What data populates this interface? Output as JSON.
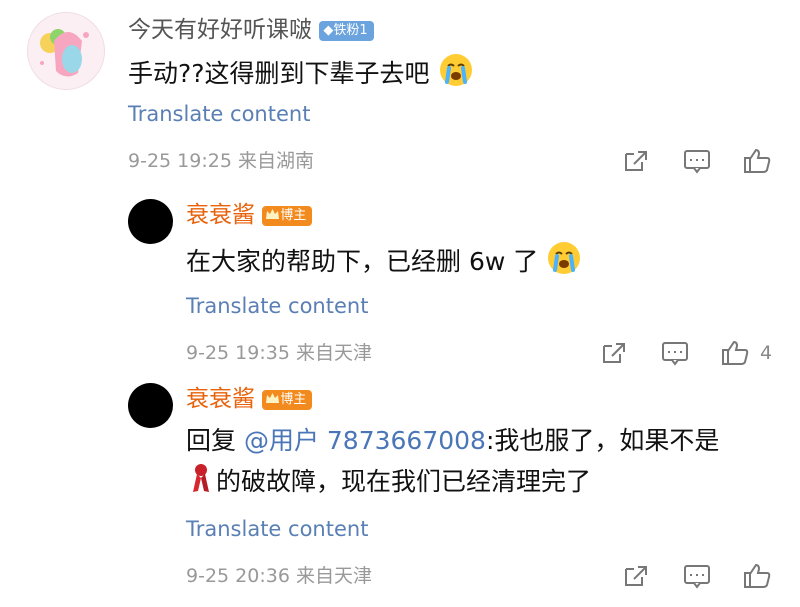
{
  "comment": {
    "username": "今天有好好听课啵",
    "fan_badge": "铁粉1",
    "text": "手动??这得删到下辈子去吧",
    "translate": "Translate content",
    "time": "9-25 19:25",
    "location": "来自湖南"
  },
  "replies": [
    {
      "username": "衰衰酱",
      "badge": "博主",
      "text": "在大家的帮助下，已经删 6w 了",
      "translate": "Translate content",
      "time": "9-25 19:35",
      "location": "来自天津",
      "likes": "4"
    },
    {
      "username": "衰衰酱",
      "badge": "博主",
      "reply_prefix": "回复 ",
      "mention": "@用户 7873667008",
      "text_line1": ":我也服了，如果不是",
      "text_line2": "的破故障，现在我们已经清理完了",
      "translate": "Translate content",
      "time": "9-25 20:36",
      "location": "来自天津"
    }
  ],
  "colors": {
    "orange_username": "#e8620b",
    "translate_link": "#5a7fb4",
    "mention": "#4a76b8",
    "fan_badge": "#6aa3dd",
    "blogger_badge": "#f28a1d"
  }
}
